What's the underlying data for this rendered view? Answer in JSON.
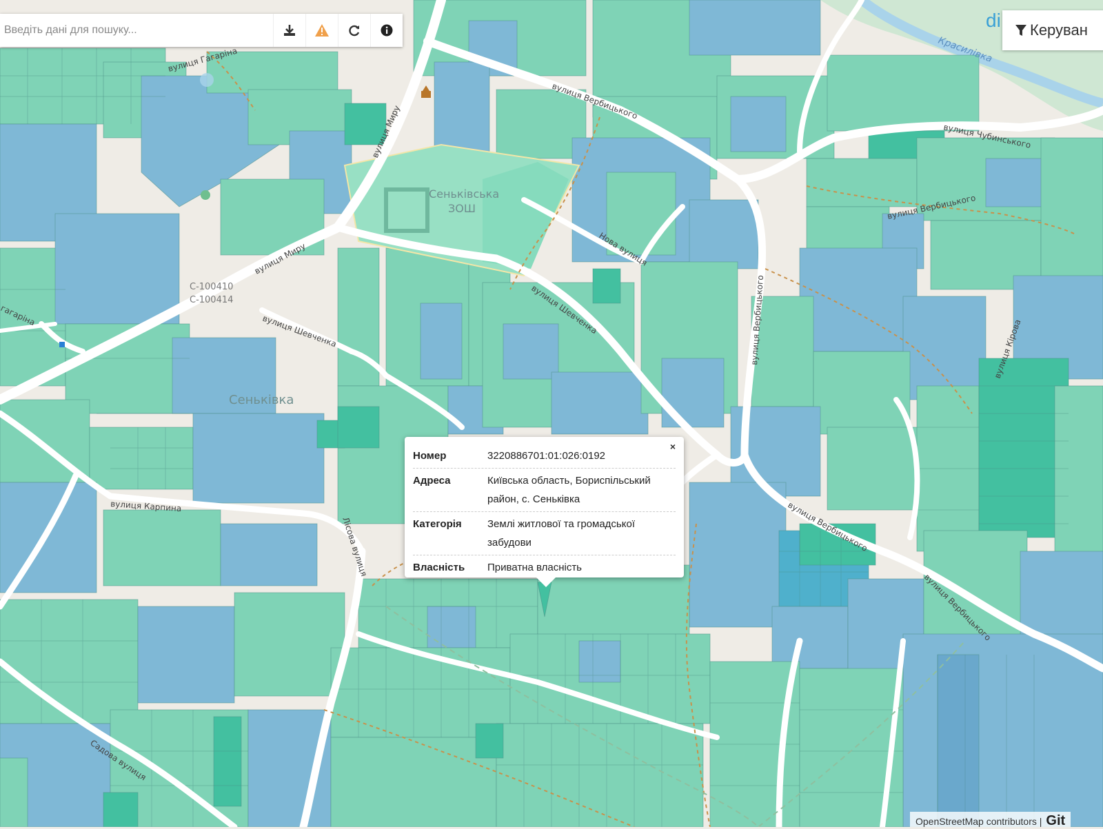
{
  "search": {
    "placeholder": "Введіть дані для пошуку...",
    "download_icon": "download-icon",
    "warning_icon": "warning-icon",
    "refresh_icon": "refresh-icon",
    "info_icon": "info-icon"
  },
  "brand": {
    "text": "di"
  },
  "control": {
    "label": "Керуван",
    "icon": "filter-icon"
  },
  "map": {
    "place_labels": [
      "Сеньківка",
      "Сеньківська",
      "ЗОШ"
    ],
    "ref_labels": [
      "С-100410",
      "С-100414"
    ],
    "river_label": "Красилівка",
    "street_labels": [
      "вулиця Гагаріна",
      "гагаріна",
      "вулиця Миру",
      "вулиця Миру",
      "вулиця Вербицького",
      "вулиця Чубинського",
      "вулиця Вербицького",
      "Нова вулиця",
      "вулиця Шевченка",
      "вулиця Шевченка",
      "вулиця Вербицького",
      "вулиця Карпина",
      "Лісова вулиця",
      "вулиця Вербицького",
      "вулиця Вербицького",
      "Садова вулиця",
      "вулиця Кірова"
    ],
    "colors": {
      "parcel_teal": "#7fd3b6",
      "parcel_blue": "#7fb8d6",
      "parcel_dark": "#43c0a0",
      "road": "#ffffff",
      "background": "#f0ede8",
      "water": "#a9d3ea"
    }
  },
  "popup": {
    "close": "×",
    "rows": [
      {
        "key": "Номер",
        "value": "3220886701:01:026:0192"
      },
      {
        "key": "Адреса",
        "value": "Київська область, Бориспільський район, с. Сеньківка"
      },
      {
        "key": "Категорія",
        "value": "Землі житлової та громадської забудови"
      },
      {
        "key": "Власність",
        "value": "Приватна власність"
      }
    ]
  },
  "attribution": {
    "text": "OpenStreetMap contributors |",
    "brand": "Git"
  }
}
